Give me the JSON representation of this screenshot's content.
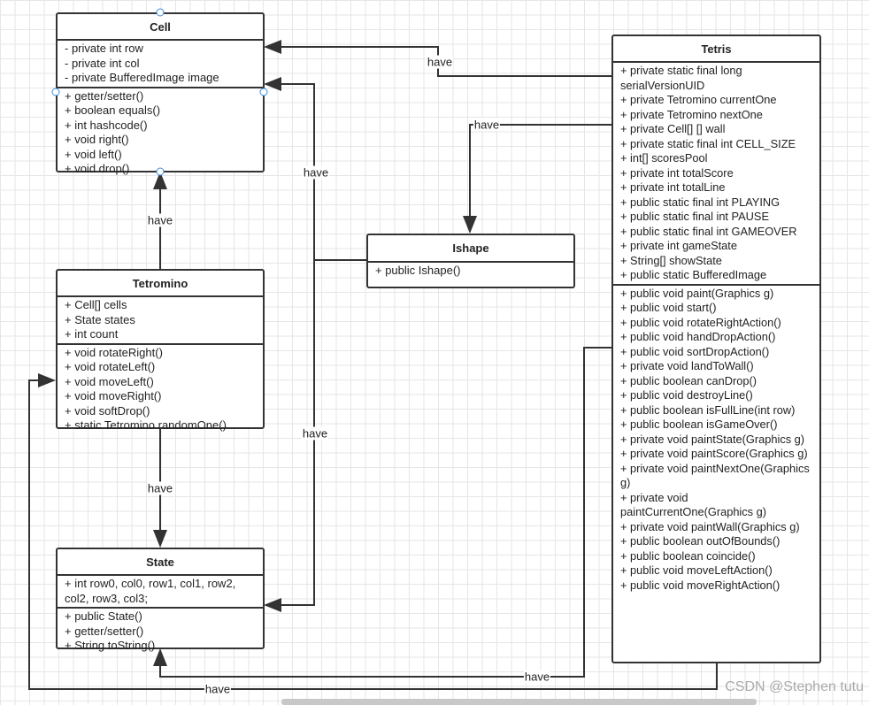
{
  "classes": {
    "cell": {
      "name": "Cell",
      "attrs": [
        "-  private int row",
        "-  private int col",
        "-  private BufferedImage image"
      ],
      "methods": [
        "+  getter/setter()",
        "+  boolean equals()",
        "+  int hashcode()",
        "+  void right()",
        "+  void left()",
        "+  void drop()"
      ]
    },
    "tetromino": {
      "name": "Tetromino",
      "attrs": [
        "+  Cell[] cells",
        "+  State states",
        "+  int count"
      ],
      "methods": [
        "+  void rotateRight()",
        "+  void rotateLeft()",
        "+  void moveLeft()",
        "+  void moveRight()",
        "+  void softDrop()",
        "+  static Tetromino randomOne()"
      ]
    },
    "state": {
      "name": "State",
      "attrs": [
        "+  int row0, col0, row1, col1, row2, col2, row3, col3;"
      ],
      "methods": [
        "+  public State()",
        "+  getter/setter()",
        "+  String toString()"
      ]
    },
    "ishape": {
      "name": "Ishape",
      "attrs": [
        "+  public Ishape()"
      ],
      "methods": []
    },
    "tetris": {
      "name": "Tetris",
      "attrs": [
        "+ private static final long serialVersionUID",
        "+ private Tetromino currentOne",
        "+ private Tetromino nextOne",
        "+ private Cell[] [] wall",
        "+ private static final int CELL_SIZE",
        "+ int[] scoresPool",
        "+ private int totalScore",
        "+ private int totalLine",
        "+ public static final int PLAYING",
        "+ public static final int PAUSE",
        "+ public static final int GAMEOVER",
        "+ private int gameState",
        "+ String[] showState",
        "+ public static BufferedImage"
      ],
      "methods": [
        "+ public void paint(Graphics g)",
        "+ public void start()",
        "+ public void rotateRightAction()",
        "+ public void handDropAction()",
        "+ public void sortDropAction()",
        "+ private void landToWall()",
        "+ public boolean canDrop()",
        "+ public void destroyLine()",
        "+ public boolean isFullLine(int row)",
        "+ public boolean isGameOver()",
        "+ private void paintState(Graphics g)",
        "+ private void paintScore(Graphics g)",
        "+ private void paintNextOne(Graphics g)",
        "+ private void paintCurrentOne(Graphics g)",
        "+ private void paintWall(Graphics g)",
        "+ public boolean outOfBounds()",
        "+ public boolean coincide()",
        "+ public void moveLeftAction()",
        "+ public void moveRightAction()"
      ]
    }
  },
  "labels": {
    "tetris_cell": "have",
    "ishape_cell": "have",
    "tetris_ishape": "have",
    "tetromino_cell": "have",
    "ishape_state": "have",
    "tetromino_state": "have",
    "tetris_state": "have",
    "tetris_tetromino": "have"
  },
  "watermark": "CSDN @Stephen tutu"
}
